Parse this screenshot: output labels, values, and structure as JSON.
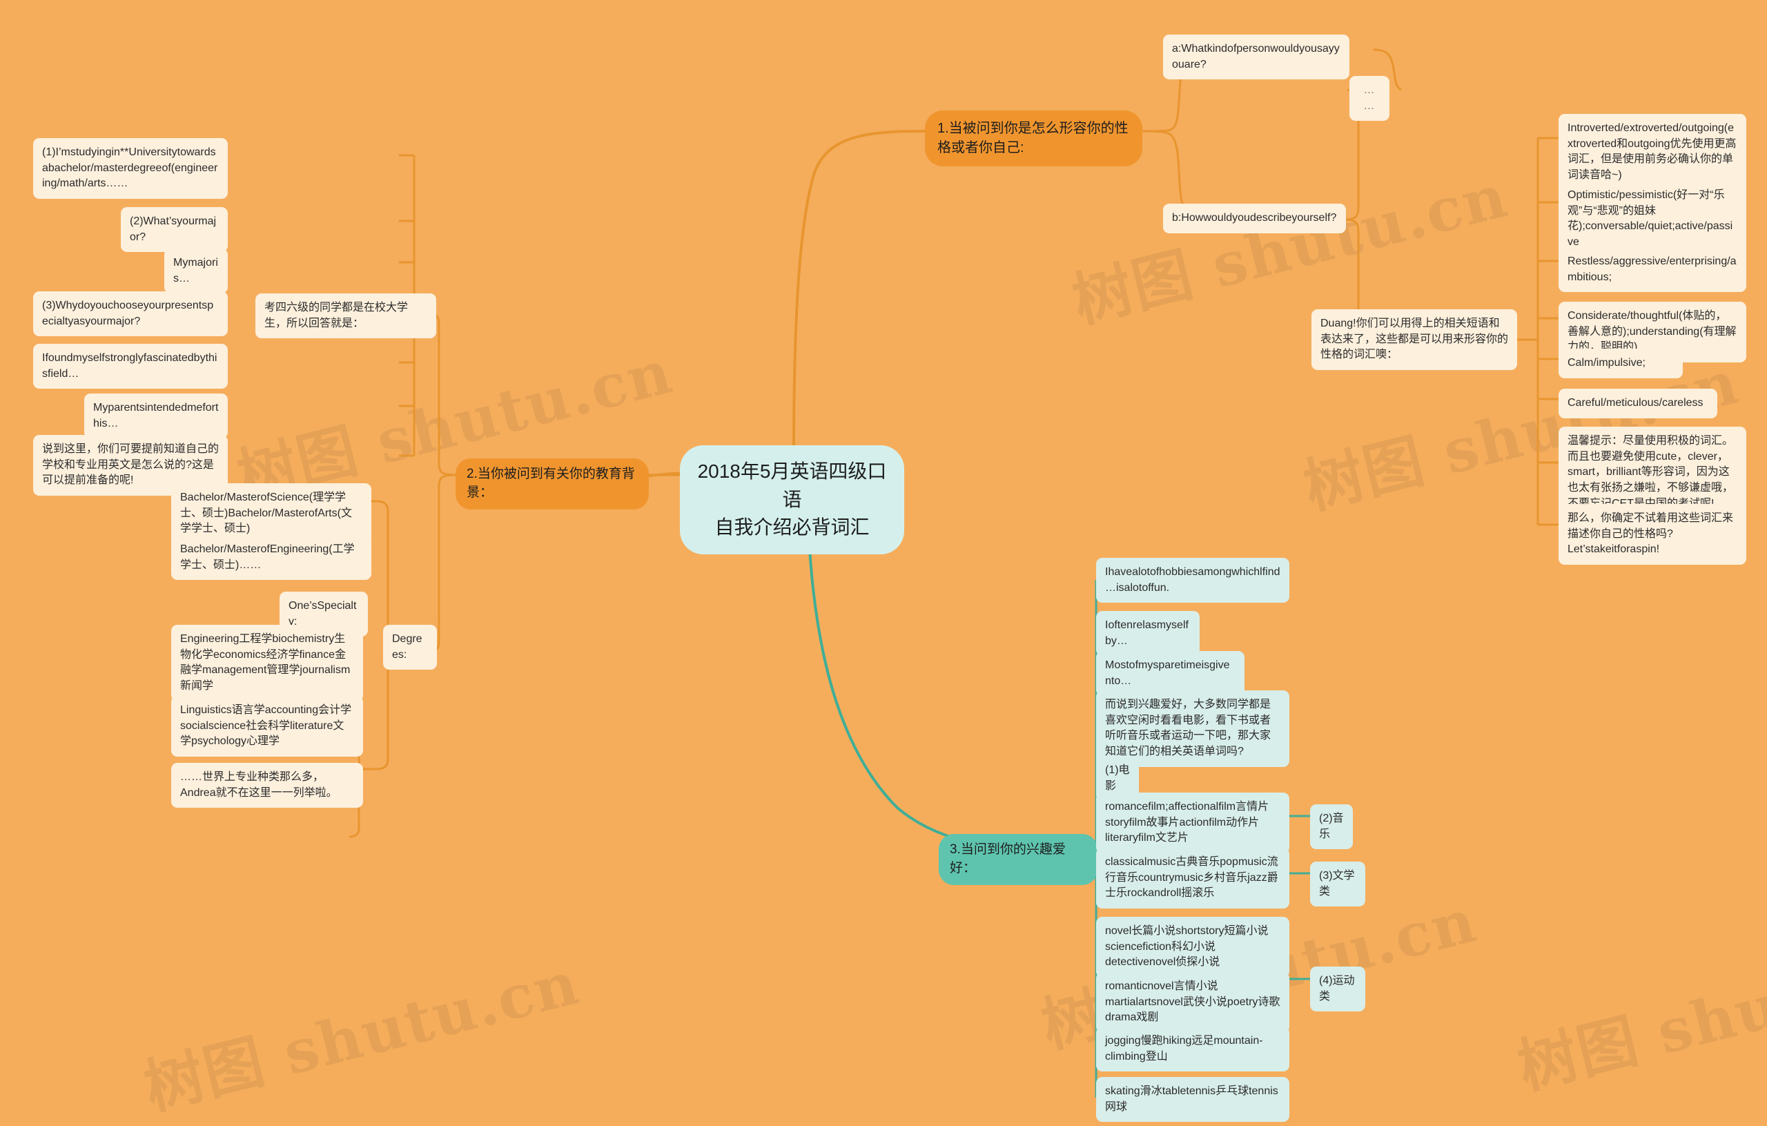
{
  "watermarks": [
    "树图 shutu.cn",
    "树图 shutu.cn",
    "树图 shutu.cn",
    "树图 shutu.cn",
    "树图 shutu.cn",
    "树图 shutu.cn"
  ],
  "center": {
    "title": "2018年5月英语四级口语\n自我介绍必背词汇"
  },
  "branch1": {
    "label": "1.当被问到你是怎么形容你的性格或者你自己:",
    "children": [
      {
        "id": "b1-a",
        "text": "a:Whatkindofpersonwouldyousayyouare?"
      },
      {
        "id": "b1-b",
        "text": "b:Howwouldyoudescribeyourself?"
      }
    ],
    "dots": "……",
    "duang": "Duang!你们可以用得上的相关短语和表达来了，这些都是可以用来形容你的性格的词汇噢：",
    "vocab": [
      "Introverted/extroverted/outgoing(extroverted和outgoing优先使用更高词汇，但是使用前务必确认你的单词读音哈~)",
      "Optimistic/pessimistic(好一对“乐观”与“悲观”的姐妹花);conversable/quiet;active/passive",
      "Restless/aggressive/enterprising/ambitious;",
      "Considerate/thoughtful(体贴的，善解人意的);understanding(有理解力的，聪明的)",
      "Calm/impulsive;",
      "Careful/meticulous/careless",
      "温馨提示：尽量使用积极的词汇。而且也要避免使用cute，clever，smart，brilliant等形容词，因为这也太有张扬之嫌啦，不够谦虚哦，不要忘记CET是中国的考试呢!",
      "那么，你确定不试着用这些词汇来描述你自己的性格吗?Let’stakeitforaspin!"
    ]
  },
  "branch2": {
    "label": "2.当你被问到有关你的教育背景：",
    "note_students": "考四六级的同学都是在校大学生，所以回答就是：",
    "questions": [
      "(1)I’mstudyingin**Universitytowardsabachelor/masterdegreeof(engineering/math/arts……",
      "(2)What’syourmajor?",
      "Mymajoris…",
      "(3)Whydoyouchooseyourpresentspecialtyasyourmajor?",
      "Ifoundmyselfstronglyfascinatedbythisfield…",
      "Myparentsintendedmeforthis…"
    ],
    "note_prepare": "说到这里，你们可要提前知道自己的学校和专业用英文是怎么说的?这是可以提前准备的呢!",
    "degrees_label": "Degrees:",
    "degrees": [
      "Bachelor/MasterofScience(理学学士、硕士)Bachelor/MasterofArts(文学学士、硕士)",
      "Bachelor/MasterofEngineering(工学学士、硕士)……"
    ],
    "specialty_label": "One’sSpecialty:",
    "specialties": [
      "Engineering工程学biochemistry生物化学economics经济学finance金融学management管理学journalism新闻学",
      "Linguistics语言学accounting会计学socialscience社会科学literature文学psychology心理学",
      "……世界上专业种类那么多，Andrea就不在这里一一列举啦。"
    ]
  },
  "branch3": {
    "label": "3.当问到你的兴趣爱好：",
    "phrases": [
      "Ihavealotofhobbiesamongwhichlfind…isalotoffun.",
      "Ioftenrelasmyselfby…",
      "Mostofmysparetimeisgivento…"
    ],
    "note_hobby": "而说到兴趣爱好，大多数同学都是喜欢空闲时看看电影，看下书或者听听音乐或者运动一下吧，那大家知道它们的相关英语单词吗?",
    "categories": [
      {
        "label": "(1)电影"
      },
      {
        "label": "(2)音乐"
      },
      {
        "label": "(3)文学类"
      },
      {
        "label": "(4)运动类"
      }
    ],
    "items": [
      "romancefilm;affectionalfilm言情片storyfilm故事片actionfilm动作片literaryfilm文艺片",
      "classicalmusic古典音乐popmusic流行音乐countrymusic乡村音乐jazz爵士乐rockandroll摇滚乐",
      "novel长篇小说shortstory短篇小说sciencefiction科幻小说detectivenovel侦探小说",
      "romanticnovel言情小说martialartsnovel武侠小说poetry诗歌drama戏剧",
      "jogging慢跑hiking远足mountain-climbing登山",
      "skating滑冰tabletennis乒乓球tennis网球"
    ]
  },
  "colors": {
    "background": "#f5ad5c",
    "node_cream": "#fdf0dd",
    "node_mint": "#d8eeea",
    "branch_orange": "#f0952e",
    "branch_teal": "#5ec4ae",
    "edge_orange": "#e8952f",
    "edge_teal": "#3fae97"
  }
}
